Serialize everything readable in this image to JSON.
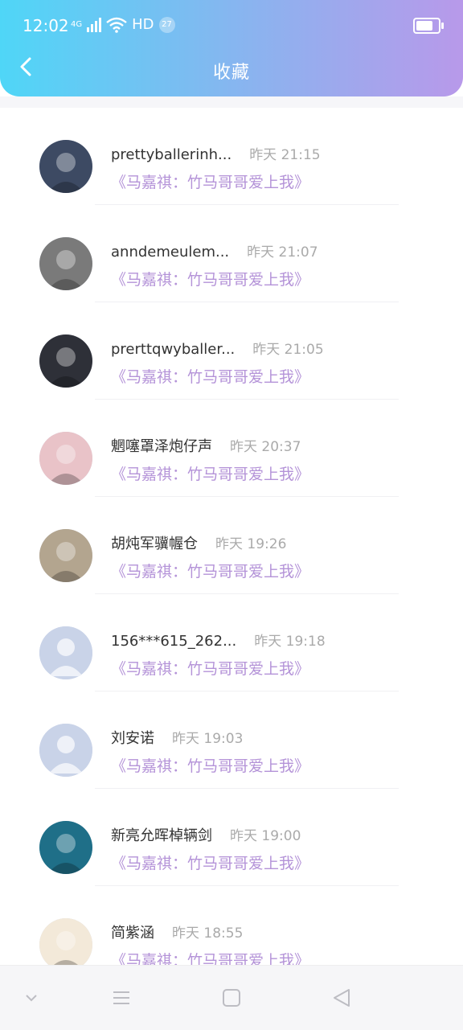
{
  "status_bar": {
    "time": "12:02",
    "network": "4G",
    "hd_label": "HD",
    "badge": "27"
  },
  "header": {
    "title": "收藏"
  },
  "favorites": [
    {
      "name": "prettyballerinh...",
      "time": "昨天 21:15",
      "book": "《马嘉祺：竹马哥哥爱上我》",
      "avatar": "photo-avatar"
    },
    {
      "name": "anndemeulem...",
      "time": "昨天 21:07",
      "book": "《马嘉祺：竹马哥哥爱上我》",
      "avatar": "photo-avatar"
    },
    {
      "name": "prerttqwyballer...",
      "time": "昨天 21:05",
      "book": "《马嘉祺：竹马哥哥爱上我》",
      "avatar": "photo-avatar"
    },
    {
      "name": "魍噻罩泽炮仔声",
      "time": "昨天 20:37",
      "book": "《马嘉祺：竹马哥哥爱上我》",
      "avatar": "photo-avatar"
    },
    {
      "name": "胡炖军骥幄仓",
      "time": "昨天 19:26",
      "book": "《马嘉祺：竹马哥哥爱上我》",
      "avatar": "photo-avatar"
    },
    {
      "name": "156***615_262...",
      "time": "昨天 19:18",
      "book": "《马嘉祺：竹马哥哥爱上我》",
      "avatar": "default-avatar"
    },
    {
      "name": "刘安诺",
      "time": "昨天 19:03",
      "book": "《马嘉祺：竹马哥哥爱上我》",
      "avatar": "default-avatar"
    },
    {
      "name": "新亮允晖棹辆剑",
      "time": "昨天 19:00",
      "book": "《马嘉祺：竹马哥哥爱上我》",
      "avatar": "photo-avatar"
    },
    {
      "name": "简紫涵",
      "time": "昨天 18:55",
      "book": "《马嘉祺：竹马哥哥爱上我》",
      "avatar": "photo-avatar"
    }
  ],
  "colors": {
    "accent_text": "#b493d8",
    "header_gradient_start": "#4fd6f7",
    "header_gradient_end": "#b899ea"
  },
  "nav_bar": {
    "icons": [
      "chevron-down-icon",
      "menu-icon",
      "home-square-icon",
      "back-triangle-icon"
    ]
  }
}
